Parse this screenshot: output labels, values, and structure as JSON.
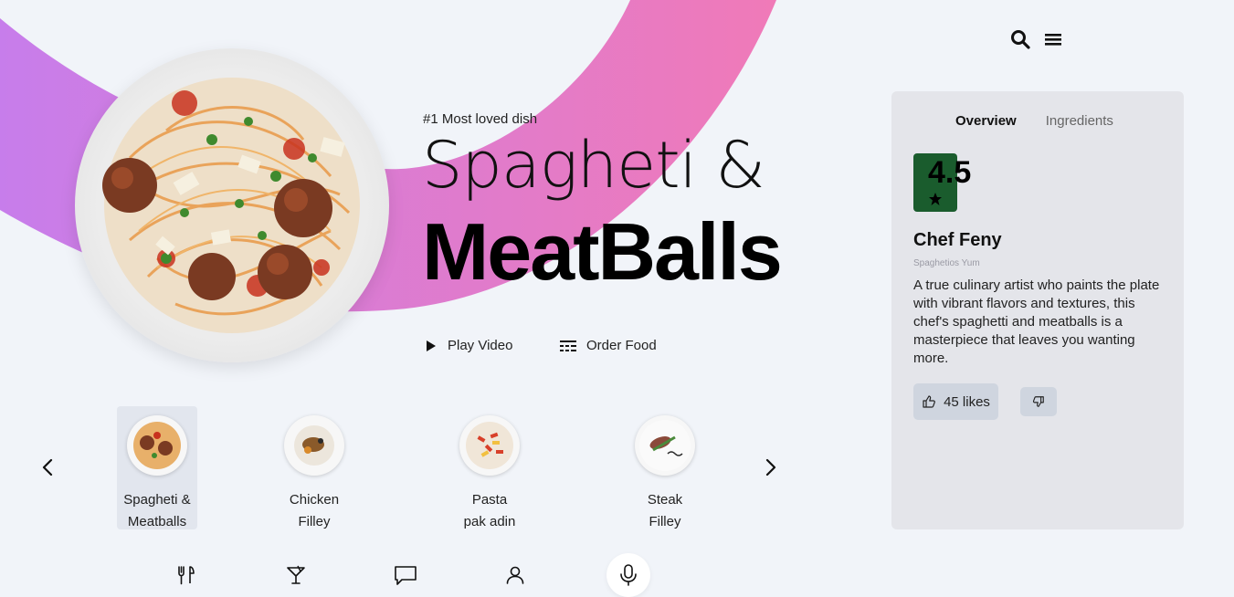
{
  "hero": {
    "tagline": "#1 Most loved dish",
    "title_line1": "Spagheti &",
    "title_line2": "MeatBalls",
    "image_icon": "spaghetti-plate-icon"
  },
  "actions": {
    "play_label": "Play Video",
    "order_label": "Order Food"
  },
  "carousel": {
    "items": [
      {
        "line1": "Spagheti &",
        "line2": "Meatballs",
        "active": true
      },
      {
        "line1": "Chicken",
        "line2": "Filley",
        "active": false
      },
      {
        "line1": "Pasta",
        "line2": "pak adin",
        "active": false
      },
      {
        "line1": "Steak",
        "line2": "Filley",
        "active": false
      }
    ]
  },
  "panel": {
    "tabs": [
      "Overview",
      "Ingredients"
    ],
    "active_tab": "Overview",
    "rating": "4.5",
    "chef_name": "Chef Feny",
    "restaurant": "Spaghetios Yum",
    "description": "A true culinary artist who paints the plate with vibrant flavors and textures, this chef's spaghetti and meatballs is a masterpiece that leaves you wanting more.",
    "likes_label": "45 likes"
  },
  "colors": {
    "background": "#f1f4f9",
    "arc_start": "#c77deb",
    "arc_end": "#f07ab8",
    "rating_badge": "#1a5c2d",
    "panel_bg": "#e4e5ea"
  },
  "icons": {
    "top": [
      "search-icon",
      "menu-icon"
    ],
    "bottom_nav": [
      "cutlery-icon",
      "cocktail-icon",
      "chat-icon",
      "user-icon",
      "microphone-icon"
    ]
  }
}
